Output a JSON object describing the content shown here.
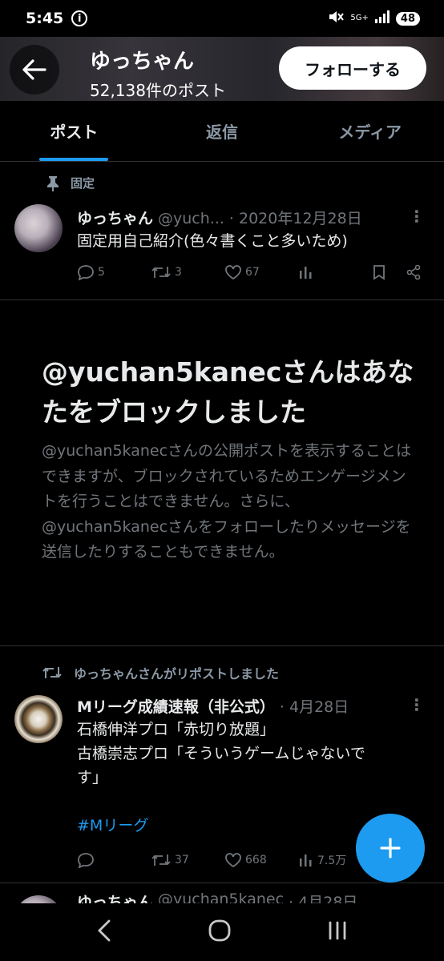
{
  "status_bar": {
    "time": "5:45",
    "network": "5G+",
    "battery": "48"
  },
  "header": {
    "profile_name": "ゆっちゃん",
    "post_count": "52,138件のポスト",
    "follow_label": "フォローする"
  },
  "tabs": [
    {
      "label": "ポスト",
      "active": true
    },
    {
      "label": "返信",
      "active": false
    },
    {
      "label": "メディア",
      "active": false
    }
  ],
  "pinned_tweet": {
    "pinned_label": "固定",
    "name": "ゆっちゃん",
    "handle": "@yuch...",
    "date": "· 2020年12月28日",
    "text": "固定用自己紹介(色々書くこと多いため)",
    "reply_count": "5",
    "repost_count": "3",
    "like_count": "67"
  },
  "block_notice": {
    "title": "@yuchan5kanecさんはあなたをブロックしました",
    "description": "@yuchan5kanecさんの公開ポストを表示することはできますが、ブロックされているためエンゲージメントを行うことはできません。さらに、@yuchan5kanecさんをフォローしたりメッセージを送信したりすることもできません。"
  },
  "repost_tweet": {
    "repost_label": "ゆっちゃんさんがリポストしました",
    "name": "Mリーグ成績速報（非公式）",
    "date": "· 4月28日",
    "line1": "石橋伸洋プロ「赤切り放題」",
    "line2": "古橋崇志プロ「そういうゲームじゃないで",
    "line3": "す」",
    "hashtag": "#Mリーグ",
    "reply_count": "",
    "repost_count": "37",
    "like_count": "668",
    "view_count": "7.5万"
  },
  "next_tweet": {
    "name": "ゆっちゃん",
    "handle": "@yuchan5kanec",
    "date": "· 4月28日"
  },
  "colors": {
    "accent": "#1d9bf0",
    "background": "#000000",
    "muted": "#71767b"
  }
}
